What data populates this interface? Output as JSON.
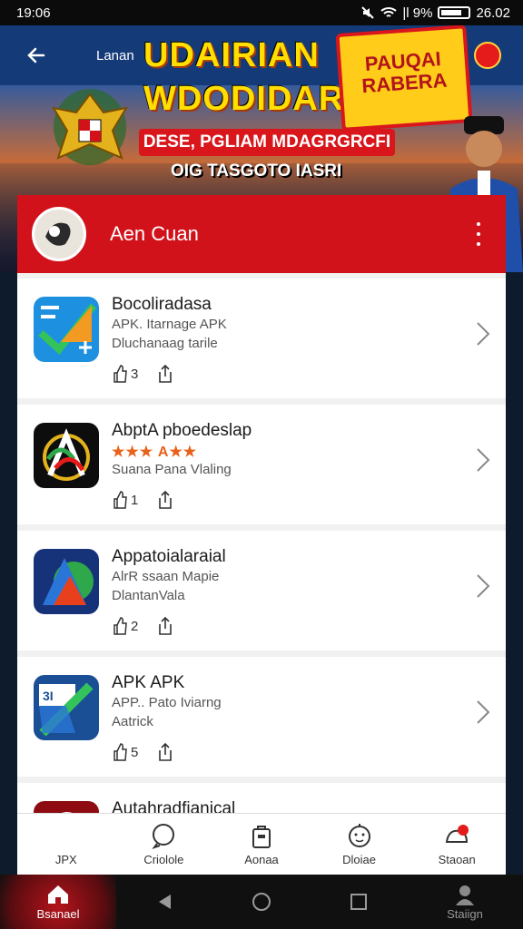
{
  "status_bar": {
    "time": "19:06",
    "battery_text": "|l 9%",
    "clock_right": "26.02"
  },
  "banner": {
    "nav_label": "Lanan",
    "headline_1": "UDAIRIAN",
    "headline_2": "WDODIDARSON",
    "promo_line_1": "PAUQAI",
    "promo_line_2": "RABERA",
    "red_bar_text": "DESE, PGLIAM MDAGRGRCFI",
    "subline": "OIG TASGOTO IASRI"
  },
  "card": {
    "title": "Aen Cuan"
  },
  "apps": [
    {
      "title": "Bocoliradasa",
      "line1": "APK. Itarnage APK",
      "line2": "Dluchanaag tarile",
      "likes": "3",
      "stars": "",
      "icon": "chart-check-icon"
    },
    {
      "title": "AbptA pboedeslap",
      "line1": "",
      "line2": "Suana Pana Vlaling",
      "likes": "1",
      "stars": "★★★ A★★",
      "icon": "a-logo-icon"
    },
    {
      "title": "Appatoialaraial",
      "line1": "AlrR ssaan Mapie",
      "line2": "DlantanVala",
      "likes": "2",
      "stars": "",
      "icon": "triangle-logo-icon"
    },
    {
      "title": "APK APK",
      "line1": "APP.. Pato Iviarng",
      "line2": "Aatrick",
      "likes": "5",
      "stars": "",
      "icon": "folder-check-icon"
    },
    {
      "title": "Autahradfianical",
      "line1": "",
      "line2": "",
      "likes": "",
      "stars": "",
      "icon": "swirl-logo-icon"
    }
  ],
  "tabs": [
    {
      "label": "JPX",
      "icon": "apk-icon"
    },
    {
      "label": "Criolole",
      "icon": "chat-icon"
    },
    {
      "label": "Aonaa",
      "icon": "bag-icon"
    },
    {
      "label": "Dloiae",
      "icon": "face-icon"
    },
    {
      "label": "Staoan",
      "icon": "notification-icon"
    }
  ],
  "navbar": {
    "home_label": "Bsanael",
    "profile_label": "Staiign"
  },
  "colors": {
    "accent_red": "#d2121a",
    "nav_blue": "#143a78",
    "headline_yellow": "#ffde00"
  }
}
